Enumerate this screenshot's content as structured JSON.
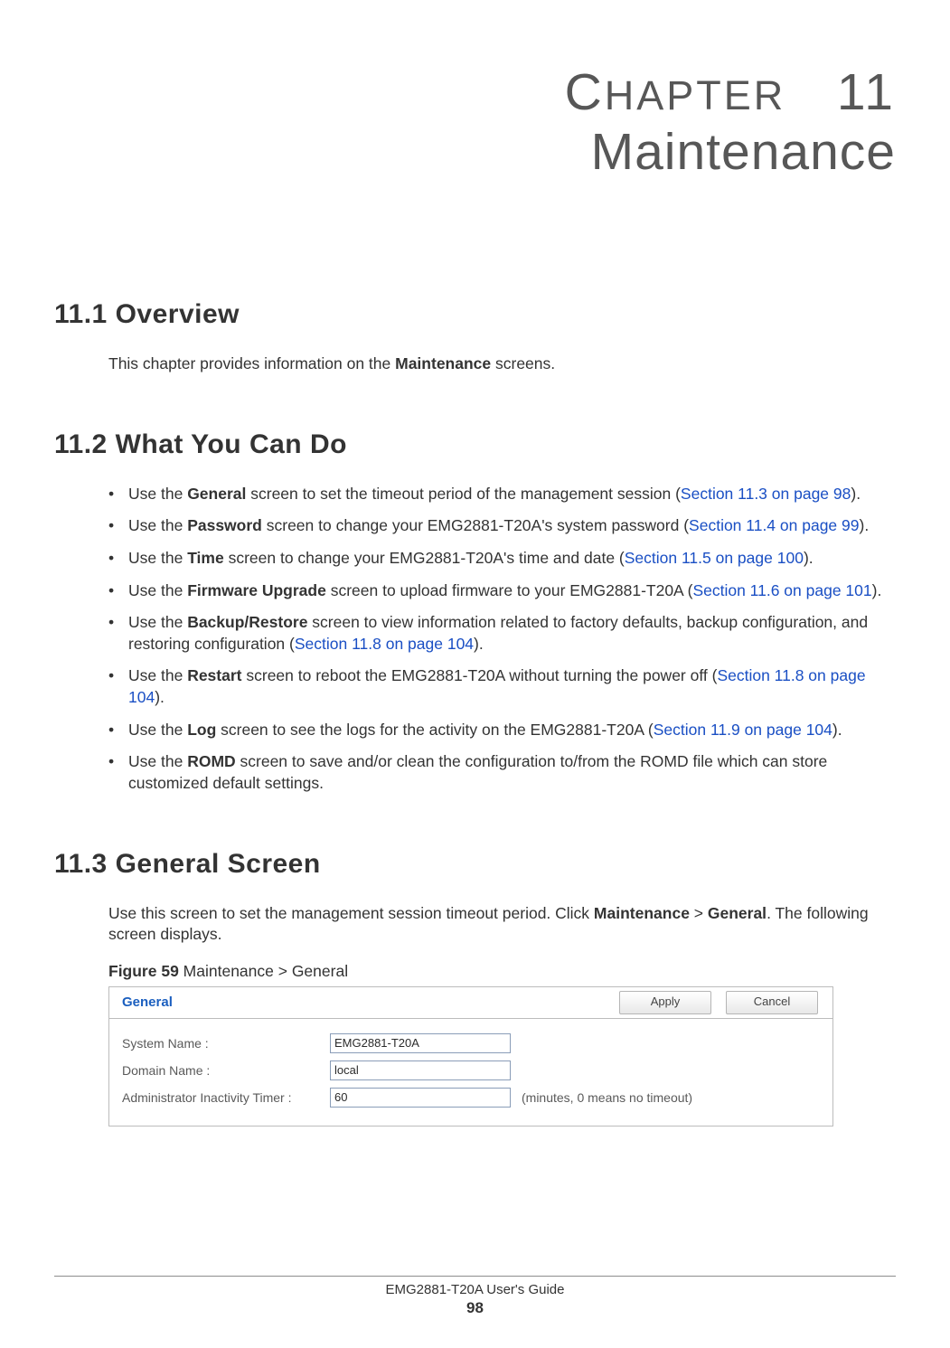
{
  "chapter": {
    "label_prefix": "C",
    "label_smallcaps": "HAPTER",
    "number": "11",
    "title": "Maintenance"
  },
  "sections": {
    "s1": {
      "heading": "11.1  Overview",
      "p1_a": "This chapter provides information on the ",
      "p1_bold": "Maintenance",
      "p1_b": " screens."
    },
    "s2": {
      "heading": "11.2  What You Can Do",
      "items": [
        {
          "pre": "Use the ",
          "bold": "General",
          "mid": " screen to set the timeout period of the management session (",
          "xref": "Section 11.3 on page 98",
          "post": ")."
        },
        {
          "pre": "Use the ",
          "bold": "Password",
          "mid": " screen to change your EMG2881-T20A's system password (",
          "xref": "Section 11.4 on page 99",
          "post": ")."
        },
        {
          "pre": "Use the ",
          "bold": "Time",
          "mid": " screen to change your EMG2881-T20A's time and date (",
          "xref": "Section 11.5 on page 100",
          "post": ")."
        },
        {
          "pre": "Use the ",
          "bold": "Firmware Upgrade",
          "mid": " screen to upload firmware to your EMG2881-T20A (",
          "xref": "Section 11.6 on page 101",
          "post": ")."
        },
        {
          "pre": "Use the ",
          "bold": "Backup/Restore",
          "mid": " screen to view information related to factory defaults, backup configuration, and restoring configuration (",
          "xref": "Section 11.8 on page 104",
          "post": ")."
        },
        {
          "pre": "Use the ",
          "bold": "Restart",
          "mid": " screen to reboot the EMG2881-T20A without turning the power off (",
          "xref": "Section 11.8 on page 104",
          "post": ")."
        },
        {
          "pre": "Use the ",
          "bold": "Log",
          "mid": " screen to see the logs for the activity on the EMG2881-T20A (",
          "xref": "Section 11.9 on page 104",
          "post": ")."
        },
        {
          "pre": "Use the ",
          "bold": "ROMD",
          "mid": " screen to save and/or clean the configuration to/from the ROMD file which can store customized default settings.",
          "xref": "",
          "post": ""
        }
      ]
    },
    "s3": {
      "heading": "11.3  General Screen",
      "p1_a": "Use this screen to set the management session timeout period. Click ",
      "p1_bold1": "Maintenance",
      "p1_mid": " > ",
      "p1_bold2": "General",
      "p1_b": ". The following screen displays."
    }
  },
  "figure": {
    "label_bold": "Figure 59",
    "label_rest": "   Maintenance > General",
    "ui": {
      "title": "General",
      "apply": "Apply",
      "cancel": "Cancel",
      "rows": {
        "system_name": {
          "label": "System Name :",
          "value": "EMG2881-T20A"
        },
        "domain_name": {
          "label": "Domain Name :",
          "value": "local"
        },
        "timer": {
          "label": "Administrator Inactivity Timer :",
          "value": "60",
          "suffix": "(minutes, 0 means no timeout)"
        }
      }
    }
  },
  "footer": {
    "guide": "EMG2881-T20A User's Guide",
    "page": "98"
  }
}
